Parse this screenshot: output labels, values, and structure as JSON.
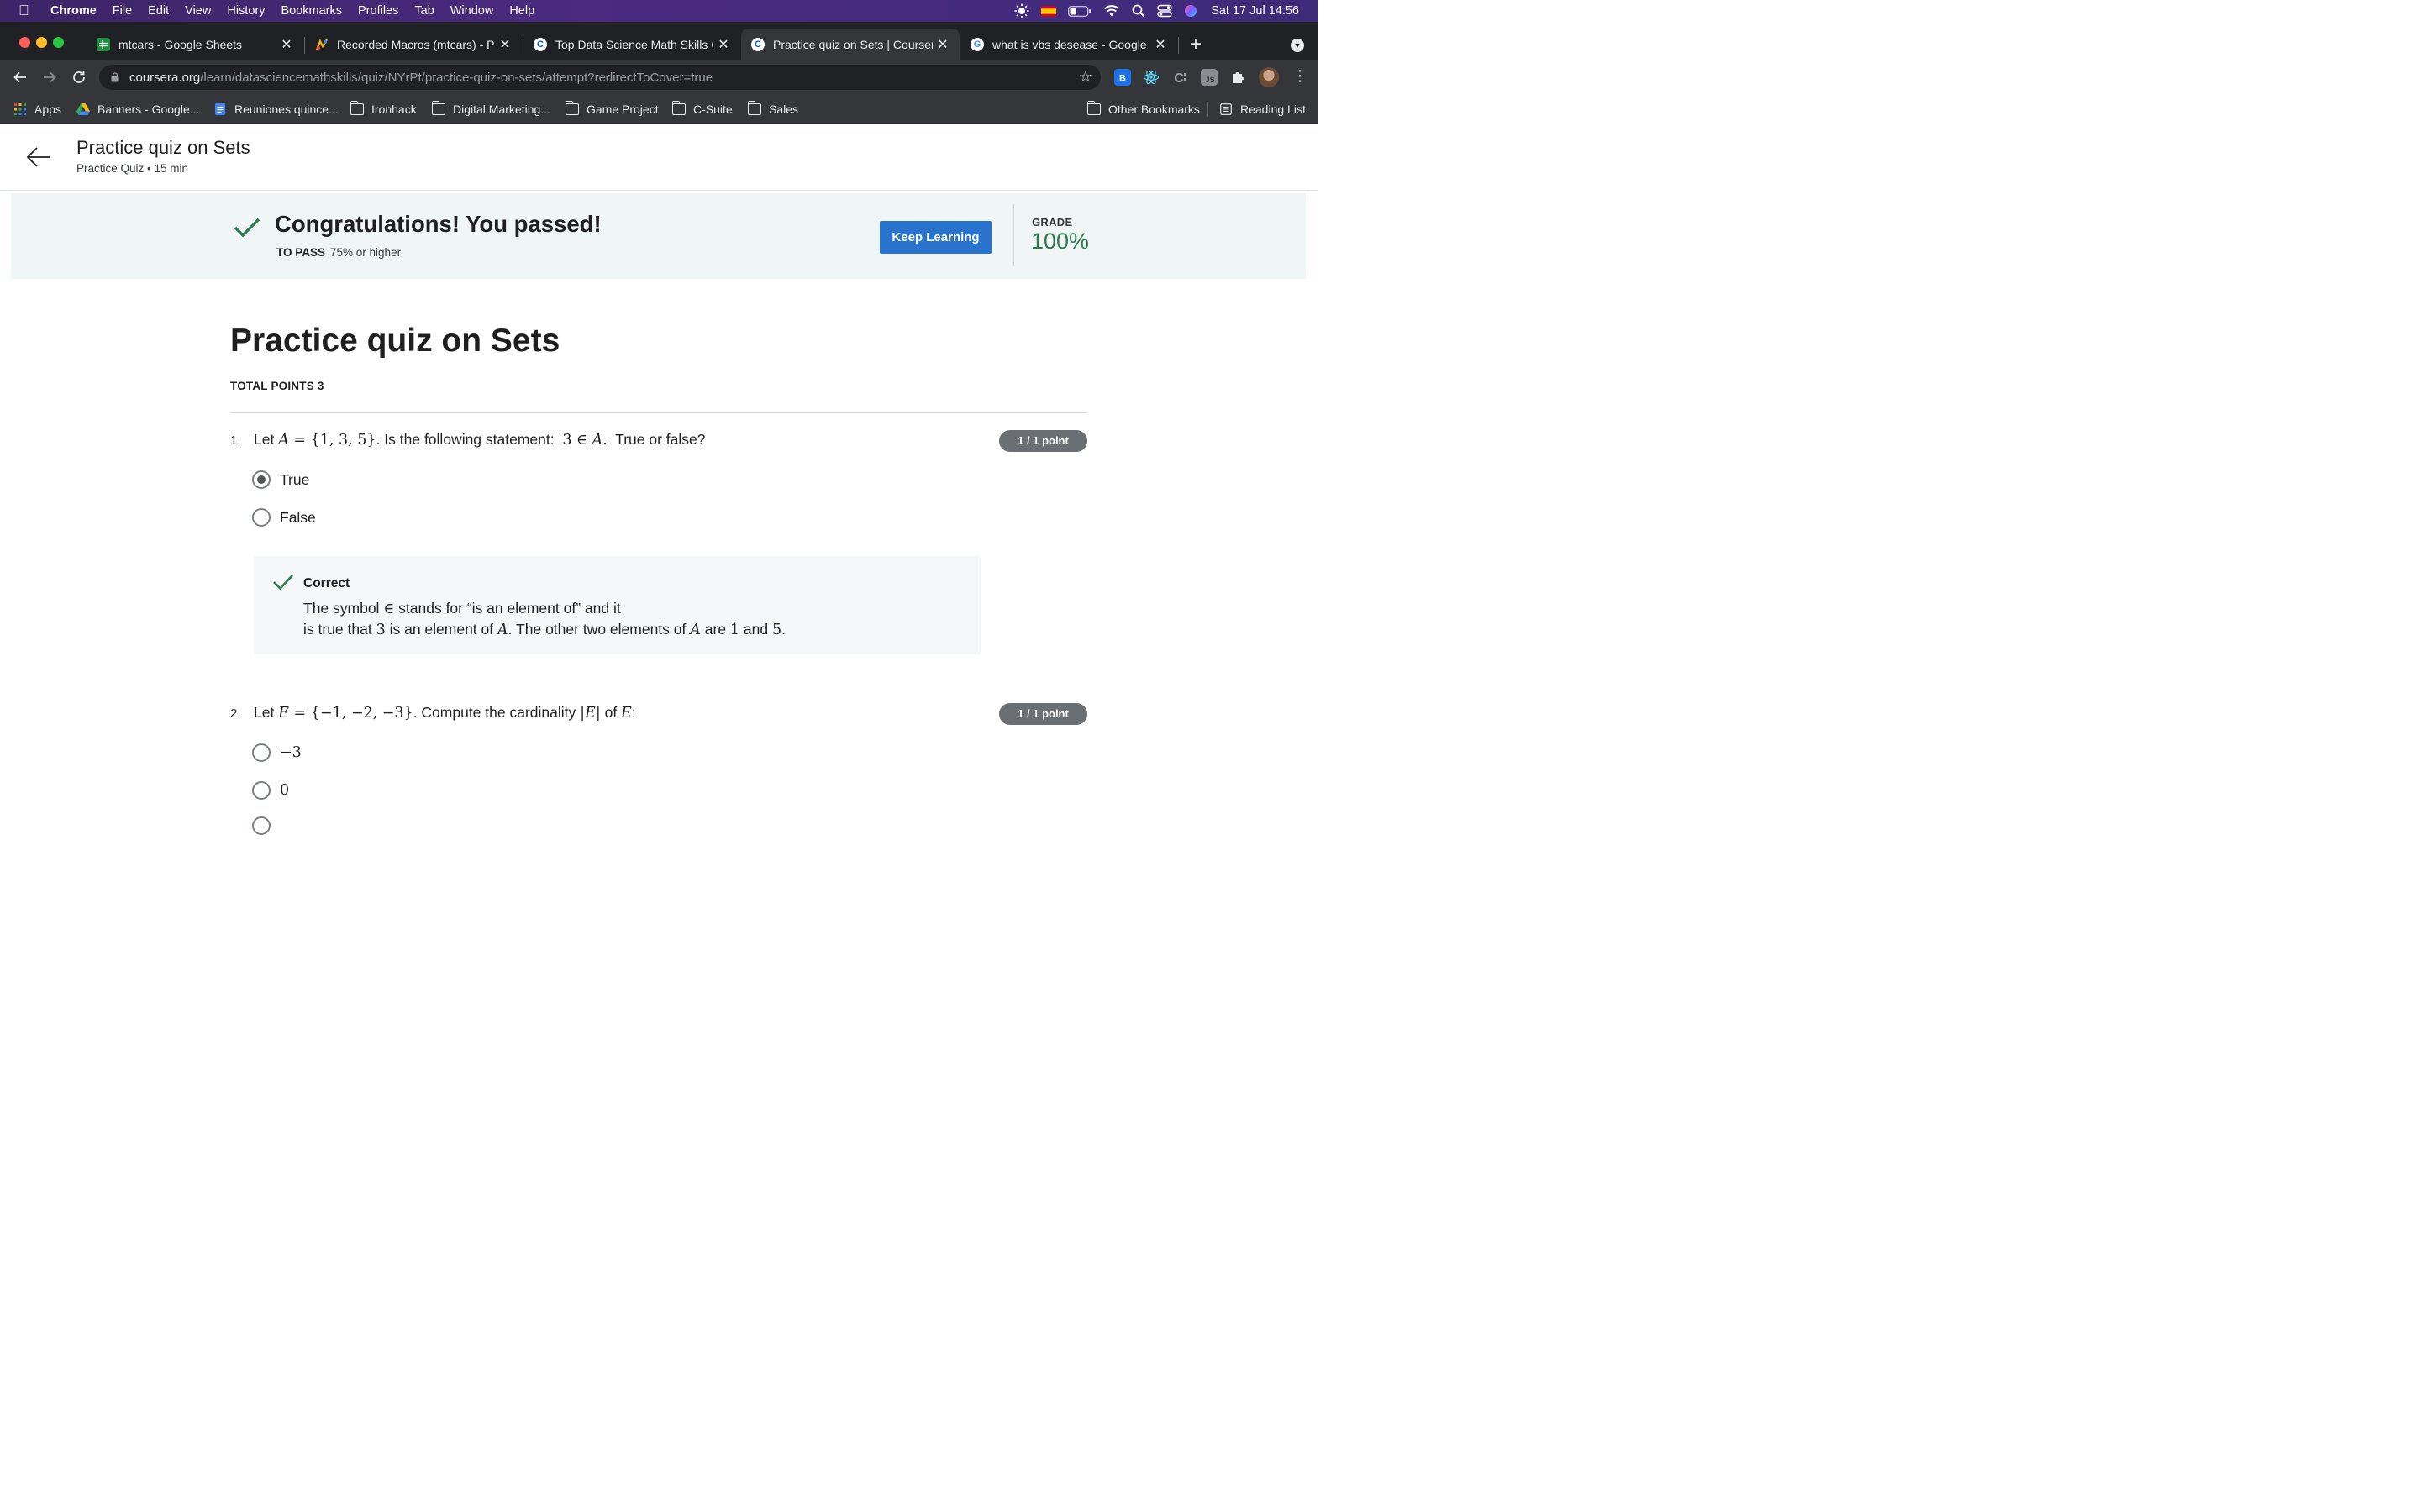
{
  "menubar": {
    "app": "Chrome",
    "items": [
      "File",
      "Edit",
      "View",
      "History",
      "Bookmarks",
      "Profiles",
      "Tab",
      "Window",
      "Help"
    ],
    "clock": "Sat 17 Jul  14:56"
  },
  "tabs": [
    {
      "title": "mtcars - Google Sheets",
      "icon": "google-sheets-icon",
      "active": false
    },
    {
      "title": "Recorded Macros (mtcars) - Pr",
      "icon": "macros-icon",
      "active": false
    },
    {
      "title": "Top Data Science Math Skills C",
      "icon": "coursera-icon",
      "active": false
    },
    {
      "title": "Practice quiz on Sets | Courser",
      "icon": "coursera-icon",
      "active": true
    },
    {
      "title": "what is vbs desease - Google S",
      "icon": "google-icon",
      "active": false
    }
  ],
  "omnibox": {
    "domain": "coursera.org",
    "path": "/learn/datasciencemathskills/quiz/NYrPt/practice-quiz-on-sets/attempt?redirectToCover=true"
  },
  "bookmarks": {
    "left": [
      "Apps",
      "Banners - Google...",
      "Reuniones quince...",
      "Ironhack",
      "Digital Marketing...",
      "Game Project",
      "C-Suite",
      "Sales"
    ],
    "right": [
      "Other Bookmarks",
      "Reading List"
    ]
  },
  "header": {
    "title": "Practice quiz on Sets",
    "subtitle": "Practice Quiz • 15 min"
  },
  "banner": {
    "message": "Congratulations! You passed!",
    "to_pass_label": "TO PASS",
    "to_pass_value": "75% or higher",
    "button": "Keep Learning",
    "grade_label": "GRADE",
    "grade_value": "100%"
  },
  "quiz": {
    "title": "Practice quiz on Sets",
    "total_points": "TOTAL POINTS 3",
    "questions": [
      {
        "number": "1.",
        "points": "1 / 1 point",
        "options": [
          "True",
          "False"
        ],
        "feedback_title": "Correct"
      },
      {
        "number": "2.",
        "points": "1 / 1 point"
      }
    ]
  },
  "colors": {
    "accent_blue": "#2a73cc",
    "success_green": "#2f7a4f",
    "banner_bg": "#f0f6f6"
  }
}
